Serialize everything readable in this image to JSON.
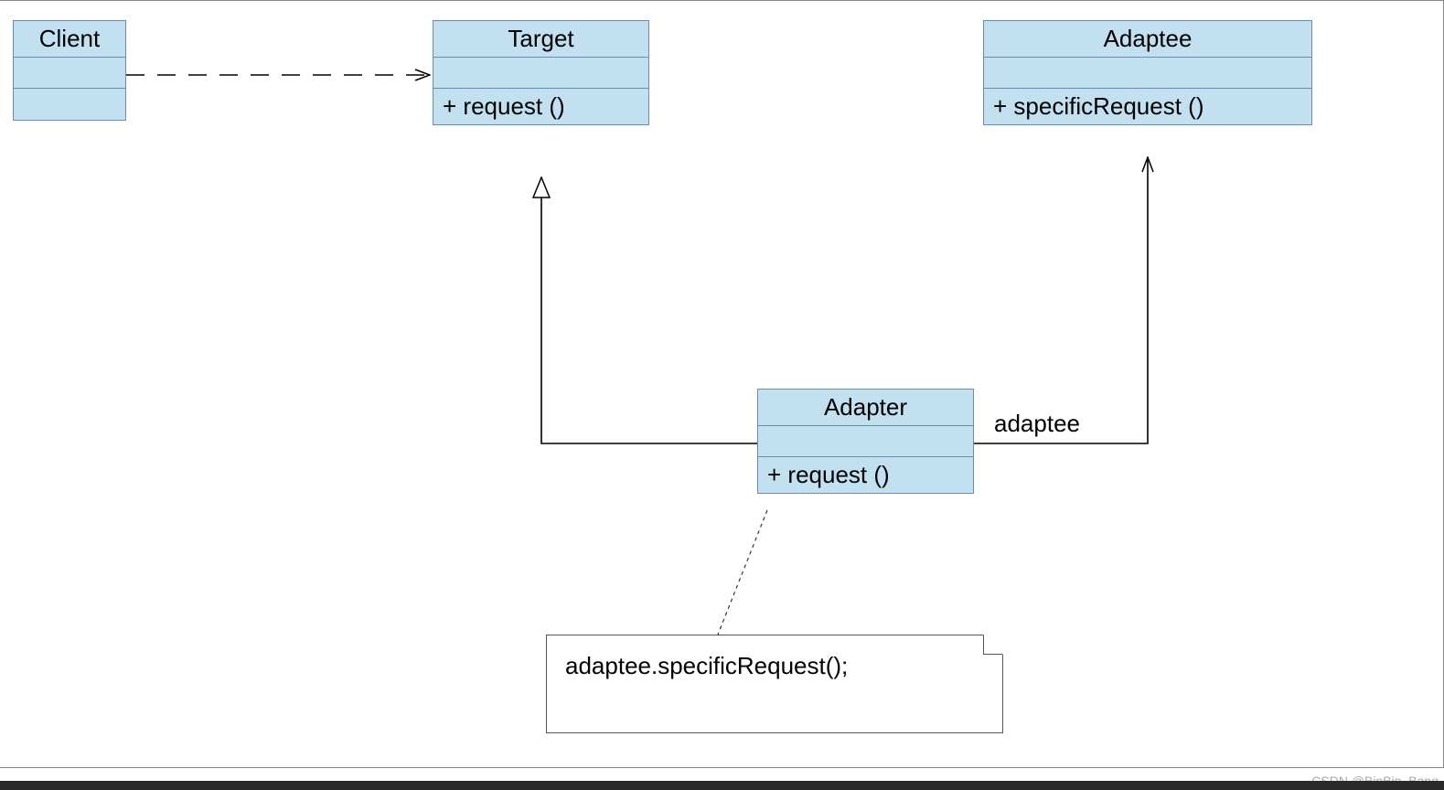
{
  "classes": {
    "client": {
      "name": "Client",
      "attrs": "",
      "ops": ""
    },
    "target": {
      "name": "Target",
      "attrs": "",
      "ops": "+  request ()"
    },
    "adaptee": {
      "name": "Adaptee",
      "attrs": "",
      "ops": "+  specificRequest ()"
    },
    "adapter": {
      "name": "Adapter",
      "attrs": "",
      "ops": "+  request ()"
    }
  },
  "association_label": "adaptee",
  "note": "adaptee.specificRequest();",
  "watermark": "CSDN @BinBin_Bang"
}
